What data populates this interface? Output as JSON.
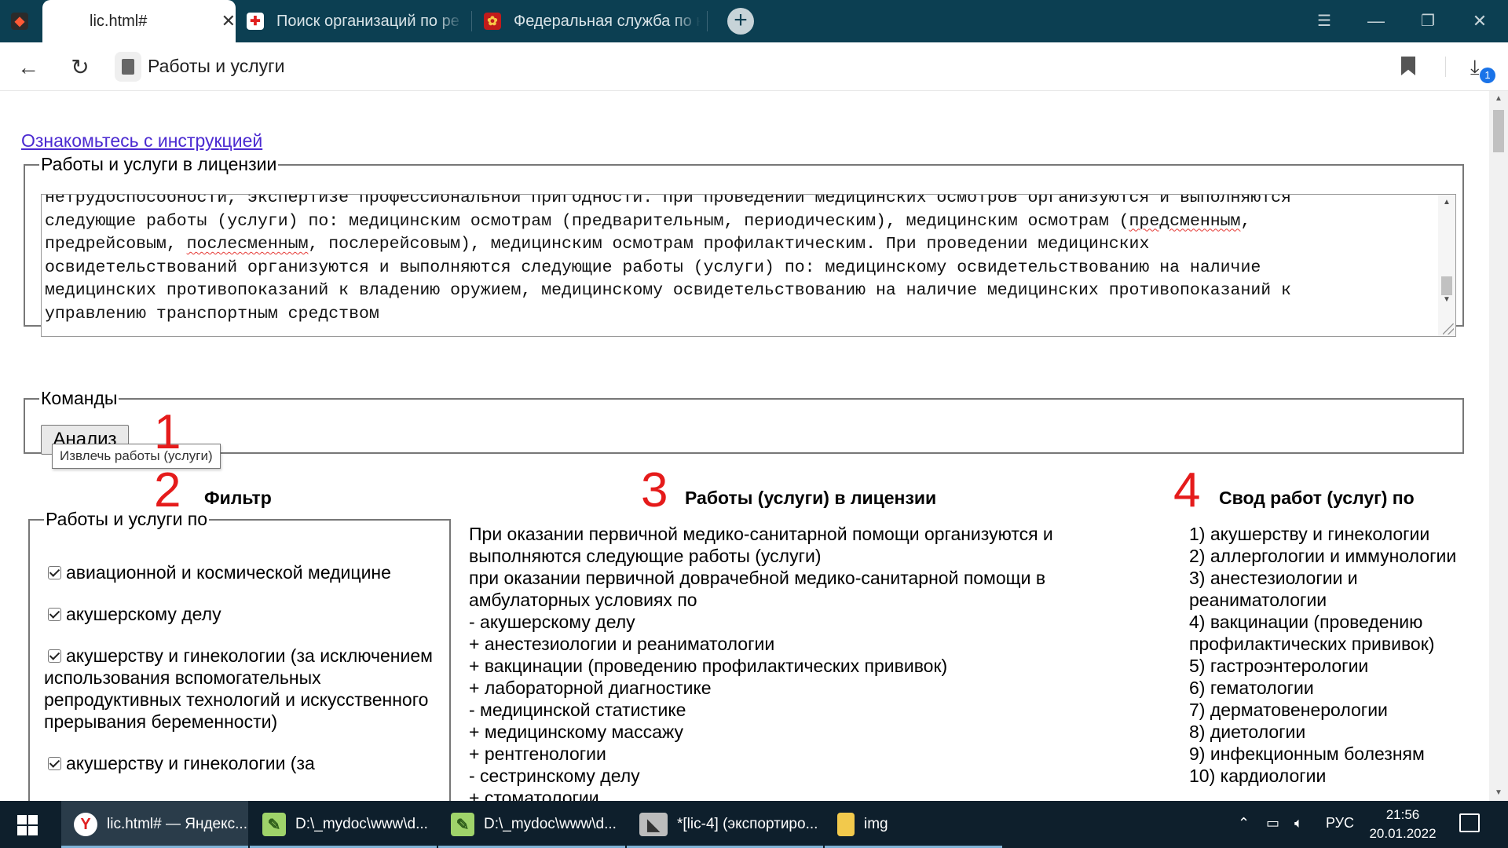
{
  "browser": {
    "tabs": [
      {
        "title": "lic.html#",
        "active": true
      },
      {
        "title": "Поиск организаций по ре",
        "active": false
      },
      {
        "title": "Федеральная служба по н",
        "active": false
      }
    ],
    "page_title": "Работы и услуги",
    "downloads_count": "1"
  },
  "page": {
    "instruction_link": "Ознакомьтесь с инструкцией",
    "works_fieldset": {
      "legend": "Работы и услуги в лицензии",
      "textarea_lines": [
        "нетрудоспособности, экспертизе профессиональной пригодности. При проведении медицинских осмотров организуются и выполняются",
        "следующие работы (услуги) по: медицинским осмотрам (предварительным, периодическим), медицинским осмотрам (",
        "предсменным",
        ",",
        "предрейсовым, ",
        "послесменным",
        ", послерейсовым), медицинским осмотрам профилактическим. При проведении медицинских",
        "освидетельствований организуются и выполняются следующие работы (услуги) по: медицинскому освидетельствованию на наличие",
        "медицинских противопоказаний к владению оружием, медицинскому освидетельствованию на наличие медицинских противопоказаний к",
        "управлению транспортным средством"
      ]
    },
    "commands": {
      "legend": "Команды",
      "analyze_button": "Анализ",
      "tooltip": "Извлечь работы (услуги)"
    },
    "markers": [
      "1",
      "2",
      "3",
      "4"
    ],
    "filter": {
      "heading": "Фильтр",
      "legend": "Работы и услуги по",
      "items": [
        "авиационной и космической медицине",
        "акушерскому делу",
        "акушерству и гинекологии (за исключением использования вспомогательных репродуктивных технологий и искусственного прерывания беременности)",
        "акушерству и гинекологии (за"
      ]
    },
    "works_in_license": {
      "heading": "Работы (услуги) в лицензии",
      "lines": [
        "При оказании первичной медико-санитарной помощи организуются и выполняются следующие работы (услуги)",
        "при оказании первичной доврачебной медико-санитарной помощи в амбулаторных условиях по",
        "- акушерскому делу",
        "+ анестезиологии и реаниматологии",
        "+ вакцинации (проведению профилактических прививок)",
        "+ лабораторной диагностике",
        "- медицинской статистике",
        "+ медицинскому массажу",
        "+ рентгенологии",
        "- сестринскому делу",
        "+ стоматологии"
      ]
    },
    "summary": {
      "heading": "Свод работ (услуг) по",
      "items": [
        "1) акушерству и гинекологии",
        "2) аллергологии и иммунологии",
        "3) анестезиологии и реаниматологии",
        "4) вакцинации (проведению профилактических прививок)",
        "5) гастроэнтерологии",
        "6) гематологии",
        "7) дерматовенерологии",
        "8) диетологии",
        "9) инфекционным болезням",
        "10) кардиологии"
      ]
    }
  },
  "taskbar": {
    "items": [
      {
        "label": "lic.html# — Яндекс...",
        "icon": "yandex-browser-icon",
        "active": true
      },
      {
        "label": "D:\\_mydoc\\www\\d...",
        "icon": "notepad-plus-icon",
        "active": false
      },
      {
        "label": "D:\\_mydoc\\www\\d...",
        "icon": "notepad-plus-icon",
        "active": false
      },
      {
        "label": "*[lic-4] (экспортиро...",
        "icon": "image-editor-icon",
        "active": false
      },
      {
        "label": "img",
        "icon": "folder-icon",
        "active": false
      }
    ],
    "language": "РУС",
    "time": "21:56",
    "date": "20.01.2022"
  },
  "colors": {
    "tabbar_bg": "#0c3f52",
    "taskbar_bg": "#0e1f2c",
    "marker_red": "#e51b1b",
    "link": "#4b2ad1"
  }
}
